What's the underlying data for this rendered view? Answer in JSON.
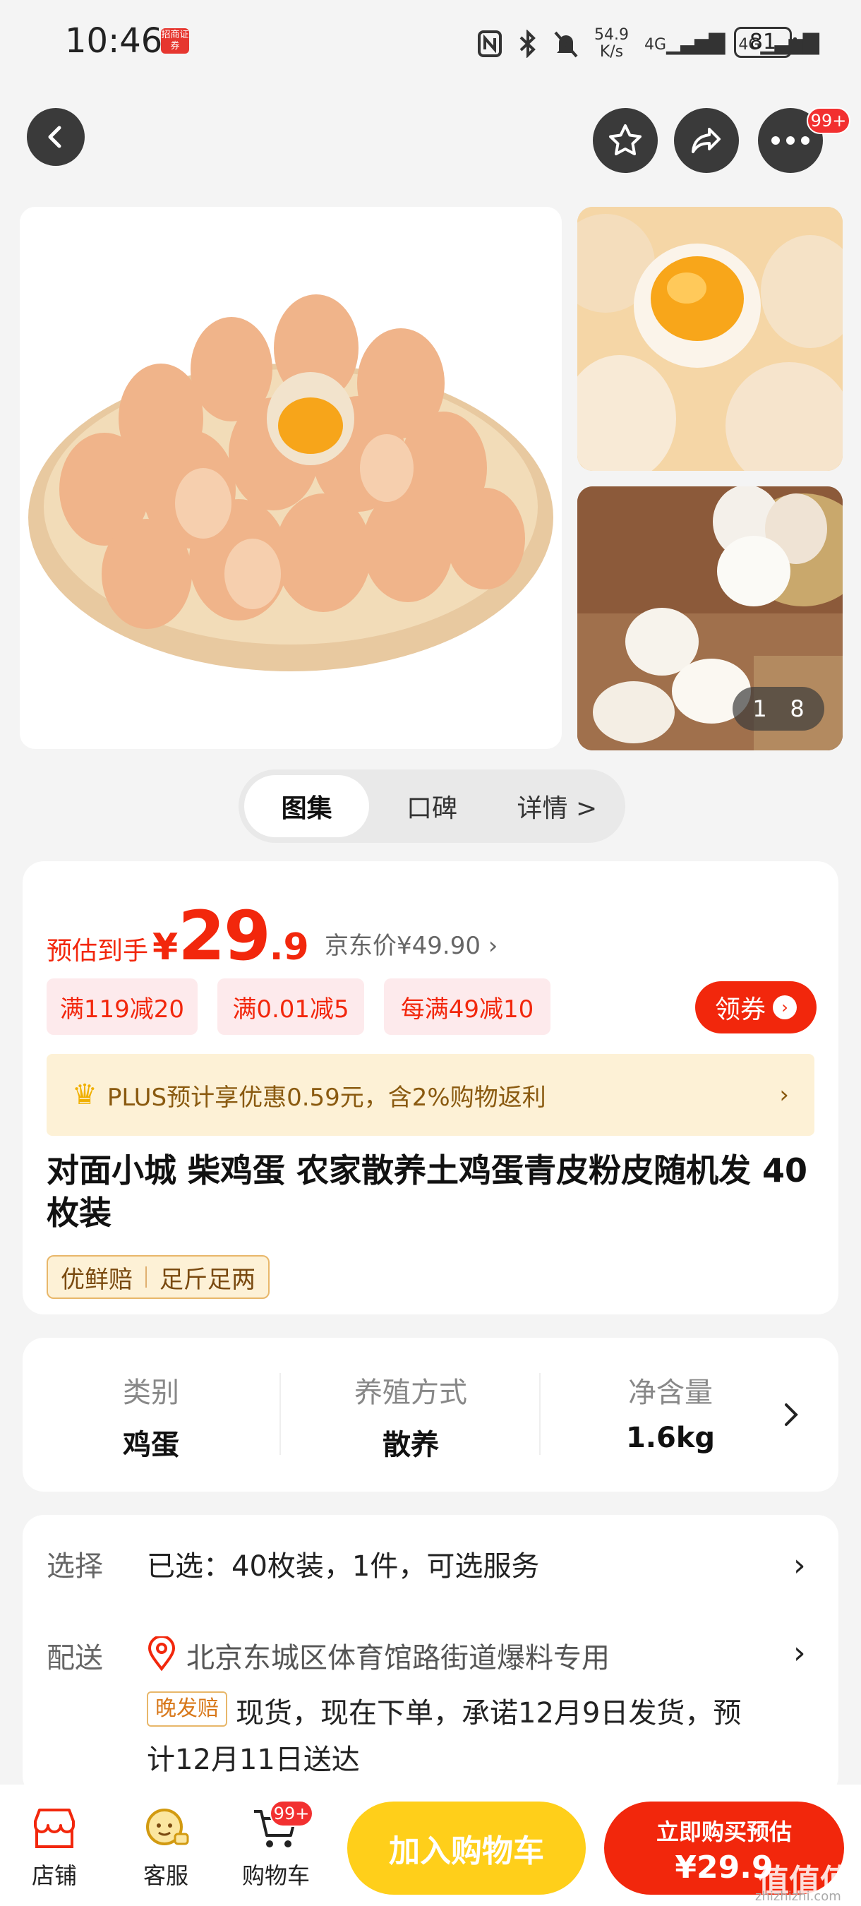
{
  "status": {
    "time": "10:46",
    "brand_badge": "招商证券",
    "net_speed_top": "54.9",
    "net_speed_bottom": "K/s",
    "sig1": "4G",
    "sig2": "4G",
    "battery": "81"
  },
  "header": {
    "more_badge": "99+"
  },
  "gallery": {
    "counter_current": "1",
    "counter_total": "8"
  },
  "tabs": [
    {
      "label": "图集"
    },
    {
      "label": "口碑"
    },
    {
      "label": "详情 >"
    }
  ],
  "price": {
    "est_label": "预估到手",
    "currency": "¥",
    "integer": "29",
    "decimal": ".9",
    "jd_price": "京东价¥49.90 ›"
  },
  "coupons": [
    "满119减20",
    "满0.01减5",
    "每满49减10"
  ],
  "get_coupon_label": "领券",
  "plus": {
    "text": "PLUS预计享优惠0.59元，含2%购物返利",
    "arrow": "›"
  },
  "product": {
    "title": "对面小城 柴鸡蛋 农家散养土鸡蛋青皮粉皮随机发 40枚装",
    "tags": [
      "优鲜赔",
      "足斤足两"
    ]
  },
  "specs": [
    {
      "key": "类别",
      "value": "鸡蛋"
    },
    {
      "key": "养殖方式",
      "value": "散养"
    },
    {
      "key": "净含量",
      "value": "1.6kg"
    }
  ],
  "select_row": {
    "label": "选择",
    "text": "已选：40枚装，1件，可选服务"
  },
  "delivery_row": {
    "label": "配送",
    "address": "北京东城区体育馆路街道爆料专用",
    "late_tag": "晚发赔",
    "line1": "现货，现在下单，承诺12月9日发货，预",
    "line2": "计12月11日送达"
  },
  "bottom": {
    "shop": "店铺",
    "service": "客服",
    "cart": "购物车",
    "cart_badge": "99+",
    "add_cart": "加入购物车",
    "buy_l1": "立即购买预估",
    "buy_l2": "¥29.9"
  },
  "watermark": {
    "main": "值值值",
    "sub": "zhizhizhi.com"
  }
}
